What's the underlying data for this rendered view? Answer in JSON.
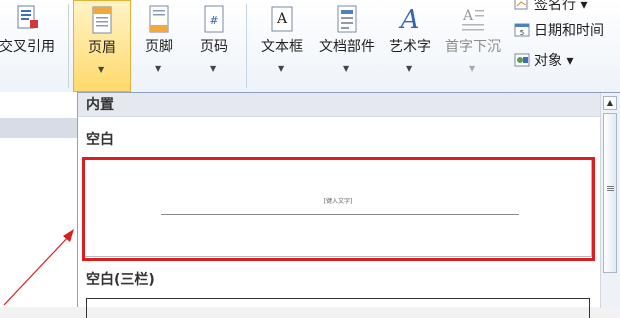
{
  "ribbon": {
    "buttons": [
      {
        "label": "交叉引用",
        "name": "cross-reference-button",
        "icon": "cross-ref-icon"
      },
      {
        "label": "页眉",
        "name": "header-button",
        "icon": "header-icon"
      },
      {
        "label": "页脚",
        "name": "footer-button",
        "icon": "footer-icon"
      },
      {
        "label": "页码",
        "name": "page-number-button",
        "icon": "page-number-icon"
      },
      {
        "label": "文本框",
        "name": "text-box-button",
        "icon": "text-box-icon"
      },
      {
        "label": "文档部件",
        "name": "quick-parts-button",
        "icon": "quick-parts-icon"
      },
      {
        "label": "艺术字",
        "name": "wordart-button",
        "icon": "wordart-icon"
      },
      {
        "label": "首字下沉",
        "name": "drop-cap-button",
        "icon": "drop-cap-icon"
      }
    ],
    "side": {
      "signature": "签名行 ▾",
      "datetime": "日期和时间",
      "object": "对象 ▾"
    }
  },
  "panel": {
    "section": "内置",
    "item1": "空白",
    "placeholder": "[键入文字]",
    "item2": "空白(三栏)"
  },
  "colors": {
    "highlight": "#d81e1e",
    "active": "#ffd96b"
  }
}
